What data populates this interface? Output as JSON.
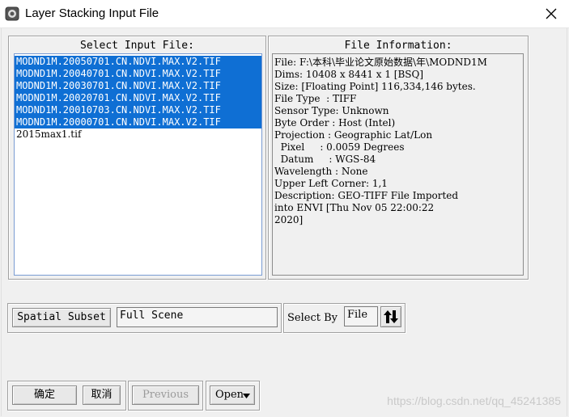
{
  "window": {
    "title": "Layer Stacking Input File"
  },
  "input_panel": {
    "title": "Select Input File:",
    "files": [
      {
        "name": "MODND1M.20050701.CN.NDVI.MAX.V2.TIF",
        "selected": true
      },
      {
        "name": "MODND1M.20040701.CN.NDVI.MAX.V2.TIF",
        "selected": true
      },
      {
        "name": "MODND1M.20030701.CN.NDVI.MAX.V2.TIF",
        "selected": true
      },
      {
        "name": "MODND1M.20020701.CN.NDVI.MAX.V2.TIF",
        "selected": true
      },
      {
        "name": "MODND1M.20010703.CN.NDVI.MAX.V2.TIF",
        "selected": true
      },
      {
        "name": "MODND1M.20000701.CN.NDVI.MAX.V2.TIF",
        "selected": true
      },
      {
        "name": "2015max1.tif",
        "selected": false
      }
    ]
  },
  "info_panel": {
    "title": "File Information:",
    "lines": [
      "File: F:\\本科\\毕业论文原始数据\\年\\MODND1M",
      "Dims: 10408 x 8441 x 1 [BSQ]",
      "Size: [Floating Point] 116,334,146 bytes.",
      "File Type  : TIFF",
      "Sensor Type: Unknown",
      "Byte Order : Host (Intel)",
      "Projection : Geographic Lat/Lon",
      "  Pixel     : 0.0059 Degrees",
      "  Datum     : WGS-84",
      "Wavelength : None",
      "Upper Left Corner: 1,1",
      "Description: GEO-TIFF File Imported",
      "into ENVI [Thu Nov 05 22:00:22",
      "2020]"
    ]
  },
  "subset": {
    "button_label": "Spatial Subset",
    "value": "Full Scene"
  },
  "select_by": {
    "label": "Select By",
    "value": "File"
  },
  "buttons": {
    "ok": "确定",
    "cancel": "取消",
    "previous": "Previous",
    "open": "Open"
  },
  "watermark": "https://blog.csdn.net/qq_45241385",
  "colors": {
    "selection": "#0f6fd4",
    "background": "#f0f0f0"
  }
}
